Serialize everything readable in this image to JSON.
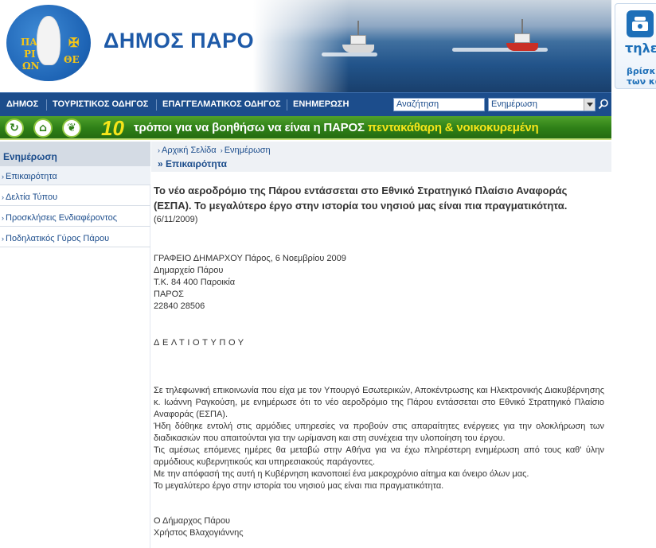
{
  "header": {
    "site_title": "ΔΗΜΟΣ ΠΑΡΟΥ",
    "logo_letters": [
      "ΠΑ",
      "ΡΙ",
      "ΩΝ",
      "ΘΕ"
    ]
  },
  "right_ad": {
    "line1": "τηλεφ",
    "line2a": "βρίσκε",
    "line2b": "των κα"
  },
  "nav": {
    "items": [
      "ΔΗΜΟΣ",
      "ΤΟΥΡΙΣΤΙΚΟΣ ΟΔΗΓΟΣ",
      "ΕΠΑΓΓΕΛΜΑΤΙΚΟΣ ΟΔΗΓΟΣ",
      "ΕΝΗΜΕΡΩΣΗ"
    ],
    "search_placeholder": "Αναζήτηση",
    "search_scope": "Ενημέρωση"
  },
  "banner": {
    "number": "10",
    "text_main": "τρόποι για να βοηθήσω να είναι η ΠΑΡΟΣ ",
    "text_highlight": "πεντακάθαρη & νοικοκυρεμένη"
  },
  "sidebar": {
    "heading": "Ενημέρωση",
    "items": [
      "Επικαιρότητα",
      "Δελτία Τύπου",
      "Προσκλήσεις Ενδιαφέροντος",
      "Ποδηλατικός Γύρος Πάρου"
    ]
  },
  "breadcrumb": {
    "home": "Αρχική Σελίδα",
    "current": "Ενημέρωση",
    "section": "» Επικαιρότητα"
  },
  "article": {
    "title": "Το νέο αεροδρόμιο της Πάρου εντάσσεται στο Εθνικό Στρατηγικό Πλαίσιο Αναφοράς (ΕΣΠΑ). Το μεγαλύτερο έργο στην ιστορία του νησιού μας είναι πια πραγματικότητα.",
    "date": "(6/11/2009)",
    "address": [
      "ΓΡΑΦΕΙΟ ΔΗΜΑΡΧΟΥ Πάρος, 6 Νοεμβρίου 2009",
      "Δημαρχείο Πάρου",
      "Τ.Κ. 84 400 Παροικία",
      "ΠΑΡΟΣ",
      "22840 28506"
    ],
    "press_label": "ΔΕΛΤΙΟΤΥΠΟΥ",
    "paragraphs": [
      "Σε τηλεφωνική επικοινωνία που είχα με τον Υπουργό Εσωτερικών, Αποκέντρωσης και Ηλεκτρονικής Διακυβέρνησης κ. Ιωάννη Ραγκούση, με ενημέρωσε ότι το νέο αεροδρόμιο της Πάρου εντάσσεται στο Εθνικό Στρατηγικό Πλαίσιο Αναφοράς (ΕΣΠΑ).",
      "Ήδη δόθηκε εντολή στις αρμόδιες υπηρεσίες να προβούν στις απαραίτητες ενέργειες για την ολοκλήρωση των διαδικασιών που απαιτούνται για την ωρίμανση και στη συνέχεια την υλοποίηση του έργου.",
      "Τις αμέσως επόμενες ημέρες θα μεταβώ στην Αθήνα για να έχω πληρέστερη ενημέρωση από τους καθ' ύλην αρμόδιους κυβερνητικούς και υπηρεσιακούς παράγοντες.",
      "Με την απόφασή της αυτή η Κυβέρνηση ικανοποιεί ένα μακροχρόνιο αίτημα και όνειρο όλων μας.",
      "Το μεγαλύτερο έργο στην ιστορία του νησιού μας είναι πια πραγματικότητα."
    ],
    "signature": [
      "Ο Δήμαρχος Πάρου",
      "Χρήστος Βλαχογιάννης"
    ]
  },
  "colors": {
    "nav_bg": "#1c4d8c",
    "banner_green": "#2e7f17",
    "banner_yellow": "#f6e51a",
    "title_blue": "#1e5aa8"
  }
}
